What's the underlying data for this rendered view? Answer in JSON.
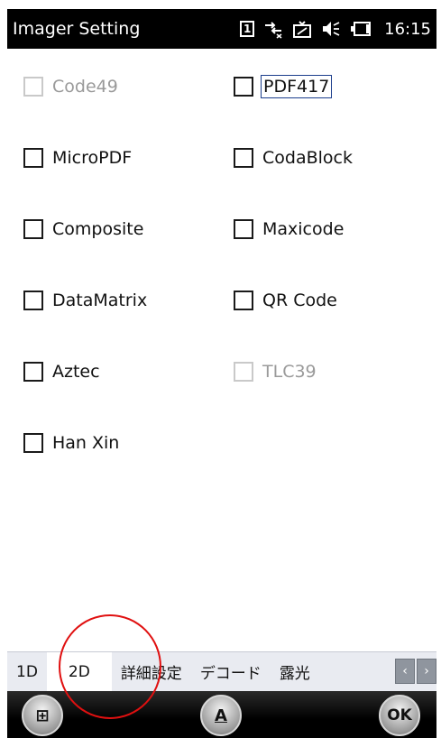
{
  "titlebar": {
    "title": "Imager Setting",
    "sim_slot": "1",
    "time": "16:15",
    "icons": [
      "sim-icon",
      "network-icon",
      "sync-icon",
      "volume-icon",
      "battery-icon"
    ]
  },
  "symbologies": [
    {
      "label": "Code49",
      "checked": false,
      "enabled": false
    },
    {
      "label": "PDF417",
      "checked": false,
      "enabled": true,
      "focused": true
    },
    {
      "label": "MicroPDF",
      "checked": false,
      "enabled": true
    },
    {
      "label": "CodaBlock",
      "checked": false,
      "enabled": true
    },
    {
      "label": "Composite",
      "checked": false,
      "enabled": true
    },
    {
      "label": "Maxicode",
      "checked": false,
      "enabled": true
    },
    {
      "label": "DataMatrix",
      "checked": false,
      "enabled": true
    },
    {
      "label": "QR Code",
      "checked": false,
      "enabled": true
    },
    {
      "label": "Aztec",
      "checked": false,
      "enabled": true
    },
    {
      "label": "TLC39",
      "checked": false,
      "enabled": false
    },
    {
      "label": "Han Xin",
      "checked": false,
      "enabled": true
    }
  ],
  "tabs": [
    {
      "label": "1D",
      "active": false
    },
    {
      "label": "2D",
      "active": true
    },
    {
      "label": "詳細設定",
      "active": false
    },
    {
      "label": "デコード",
      "active": false
    },
    {
      "label": "露光",
      "active": false
    }
  ],
  "tab_arrows": {
    "left": "‹",
    "right": "›"
  },
  "softkeys": {
    "start": "⊞",
    "input": "A",
    "ok": "OK"
  },
  "colors": {
    "titlebar": "#000000",
    "annotation": "#e01010",
    "focus_border": "#1b3d8c"
  }
}
